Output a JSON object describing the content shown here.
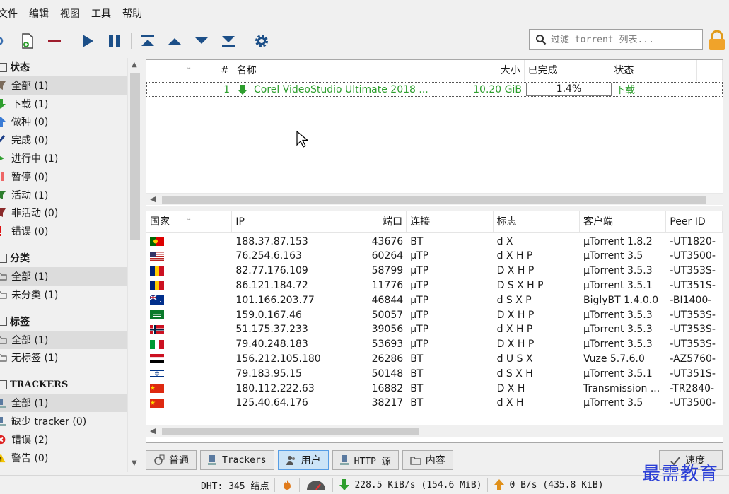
{
  "menu": [
    "文件",
    "编辑",
    "视图",
    "工具",
    "帮助"
  ],
  "search": {
    "placeholder": "过滤 torrent 列表..."
  },
  "sidebar": {
    "status_header": "状态",
    "status_items": [
      {
        "label": "全部 (1)",
        "icon": "all-filter-icon",
        "selected": true
      },
      {
        "label": "下载 (1)",
        "icon": "download-arrow-icon"
      },
      {
        "label": "做种 (0)",
        "icon": "upload-arrow-icon"
      },
      {
        "label": "完成 (0)",
        "icon": "checkmark-icon"
      },
      {
        "label": "进行中 (1)",
        "icon": "play-icon"
      },
      {
        "label": "暂停 (0)",
        "icon": "pause-icon"
      },
      {
        "label": "活动 (1)",
        "icon": "active-filter-icon"
      },
      {
        "label": "非活动 (0)",
        "icon": "inactive-filter-icon"
      },
      {
        "label": "错误 (0)",
        "icon": "error-exclamation-icon"
      }
    ],
    "category_header": "分类",
    "category_items": [
      {
        "label": "全部 (1)",
        "selected": true
      },
      {
        "label": "未分类 (1)"
      }
    ],
    "tag_header": "标签",
    "tag_items": [
      {
        "label": "全部 (1)",
        "selected": true
      },
      {
        "label": "无标签 (1)"
      }
    ],
    "tracker_header": "TRACKERS",
    "tracker_items": [
      {
        "label": "全部 (1)",
        "icon": "tracker-icon",
        "selected": true
      },
      {
        "label": "缺少 tracker (0)",
        "icon": "tracker-icon"
      },
      {
        "label": "错误 (2)",
        "icon": "error-x-icon"
      },
      {
        "label": "警告 (0)",
        "icon": "warning-icon"
      }
    ]
  },
  "torrents": {
    "headers": {
      "num": "#",
      "name": "名称",
      "size": "大小",
      "done": "已完成",
      "status": "状态"
    },
    "rows": [
      {
        "num": "1",
        "name": "Corel VideoStudio Ultimate 2018 ...",
        "size": "10.20 GiB",
        "done": "1.4%",
        "done_fraction": 0.014,
        "status": "下载"
      }
    ]
  },
  "peers": {
    "headers": {
      "country": "国家",
      "ip": "IP",
      "port": "端口",
      "conn": "连接",
      "flags": "标志",
      "client": "客户端",
      "peerid": "Peer ID"
    },
    "rows": [
      {
        "flag": "pt",
        "ip": "188.37.87.153",
        "port": "43676",
        "conn": "BT",
        "flags": "d X",
        "client": "µTorrent 1.8.2",
        "peerid": "-UT1820-"
      },
      {
        "flag": "us",
        "ip": "76.254.6.163",
        "port": "60264",
        "conn": "µTP",
        "flags": "d X H P",
        "client": "µTorrent 3.5",
        "peerid": "-UT3500-"
      },
      {
        "flag": "ro",
        "ip": "82.77.176.109",
        "port": "58799",
        "conn": "µTP",
        "flags": "D X H P",
        "client": "µTorrent 3.5.3",
        "peerid": "-UT353S-"
      },
      {
        "flag": "ro",
        "ip": "86.121.184.72",
        "port": "11776",
        "conn": "µTP",
        "flags": "D S X H P",
        "client": "µTorrent 3.5.1",
        "peerid": "-UT351S-"
      },
      {
        "flag": "au",
        "ip": "101.166.203.77",
        "port": "46844",
        "conn": "µTP",
        "flags": "d S X P",
        "client": "BiglyBT 1.4.0.0",
        "peerid": "-BI1400-"
      },
      {
        "flag": "sa",
        "ip": "159.0.167.46",
        "port": "50057",
        "conn": "µTP",
        "flags": "D X H P",
        "client": "µTorrent 3.5.3",
        "peerid": "-UT353S-"
      },
      {
        "flag": "no",
        "ip": "51.175.37.233",
        "port": "39056",
        "conn": "µTP",
        "flags": "d X H P",
        "client": "µTorrent 3.5.3",
        "peerid": "-UT353S-"
      },
      {
        "flag": "it",
        "ip": "79.40.248.183",
        "port": "53693",
        "conn": "µTP",
        "flags": "D X H P",
        "client": "µTorrent 3.5.3",
        "peerid": "-UT353S-"
      },
      {
        "flag": "eg",
        "ip": "156.212.105.180",
        "port": "26286",
        "conn": "BT",
        "flags": "d U S X",
        "client": "Vuze 5.7.6.0",
        "peerid": "-AZ5760-"
      },
      {
        "flag": "il",
        "ip": "79.183.95.15",
        "port": "50148",
        "conn": "BT",
        "flags": "d S X H",
        "client": "µTorrent 3.5.1",
        "peerid": "-UT351S-"
      },
      {
        "flag": "cn",
        "ip": "180.112.222.63",
        "port": "16882",
        "conn": "BT",
        "flags": "D X H",
        "client": "Transmission ...",
        "peerid": "-TR2840-"
      },
      {
        "flag": "cn",
        "ip": "125.40.64.176",
        "port": "38217",
        "conn": "BT",
        "flags": "d X H",
        "client": "µTorrent 3.5",
        "peerid": "-UT3500-"
      }
    ]
  },
  "tabs": [
    {
      "label": "普通",
      "icon": "general-icon",
      "mono": false,
      "active": false
    },
    {
      "label": "Trackers",
      "icon": "trackers-icon",
      "mono": true,
      "active": false
    },
    {
      "label": "用户",
      "icon": "users-icon",
      "mono": false,
      "active": true
    },
    {
      "label": "HTTP 源",
      "icon": "http-source-icon",
      "mono": true,
      "active": false
    },
    {
      "label": "内容",
      "icon": "folder-icon",
      "mono": false,
      "active": false
    }
  ],
  "speed_button": "速度",
  "statusbar": {
    "dht": "DHT: 345 结点",
    "download": "228.5  KiB/s (154.6  MiB)",
    "upload": "0  B/s (435.8  KiB)"
  },
  "watermark": "最需教育",
  "colors": {
    "green": "#2e9e2e",
    "selection": "#cce4f7",
    "watermark": "#2b3fd6"
  }
}
